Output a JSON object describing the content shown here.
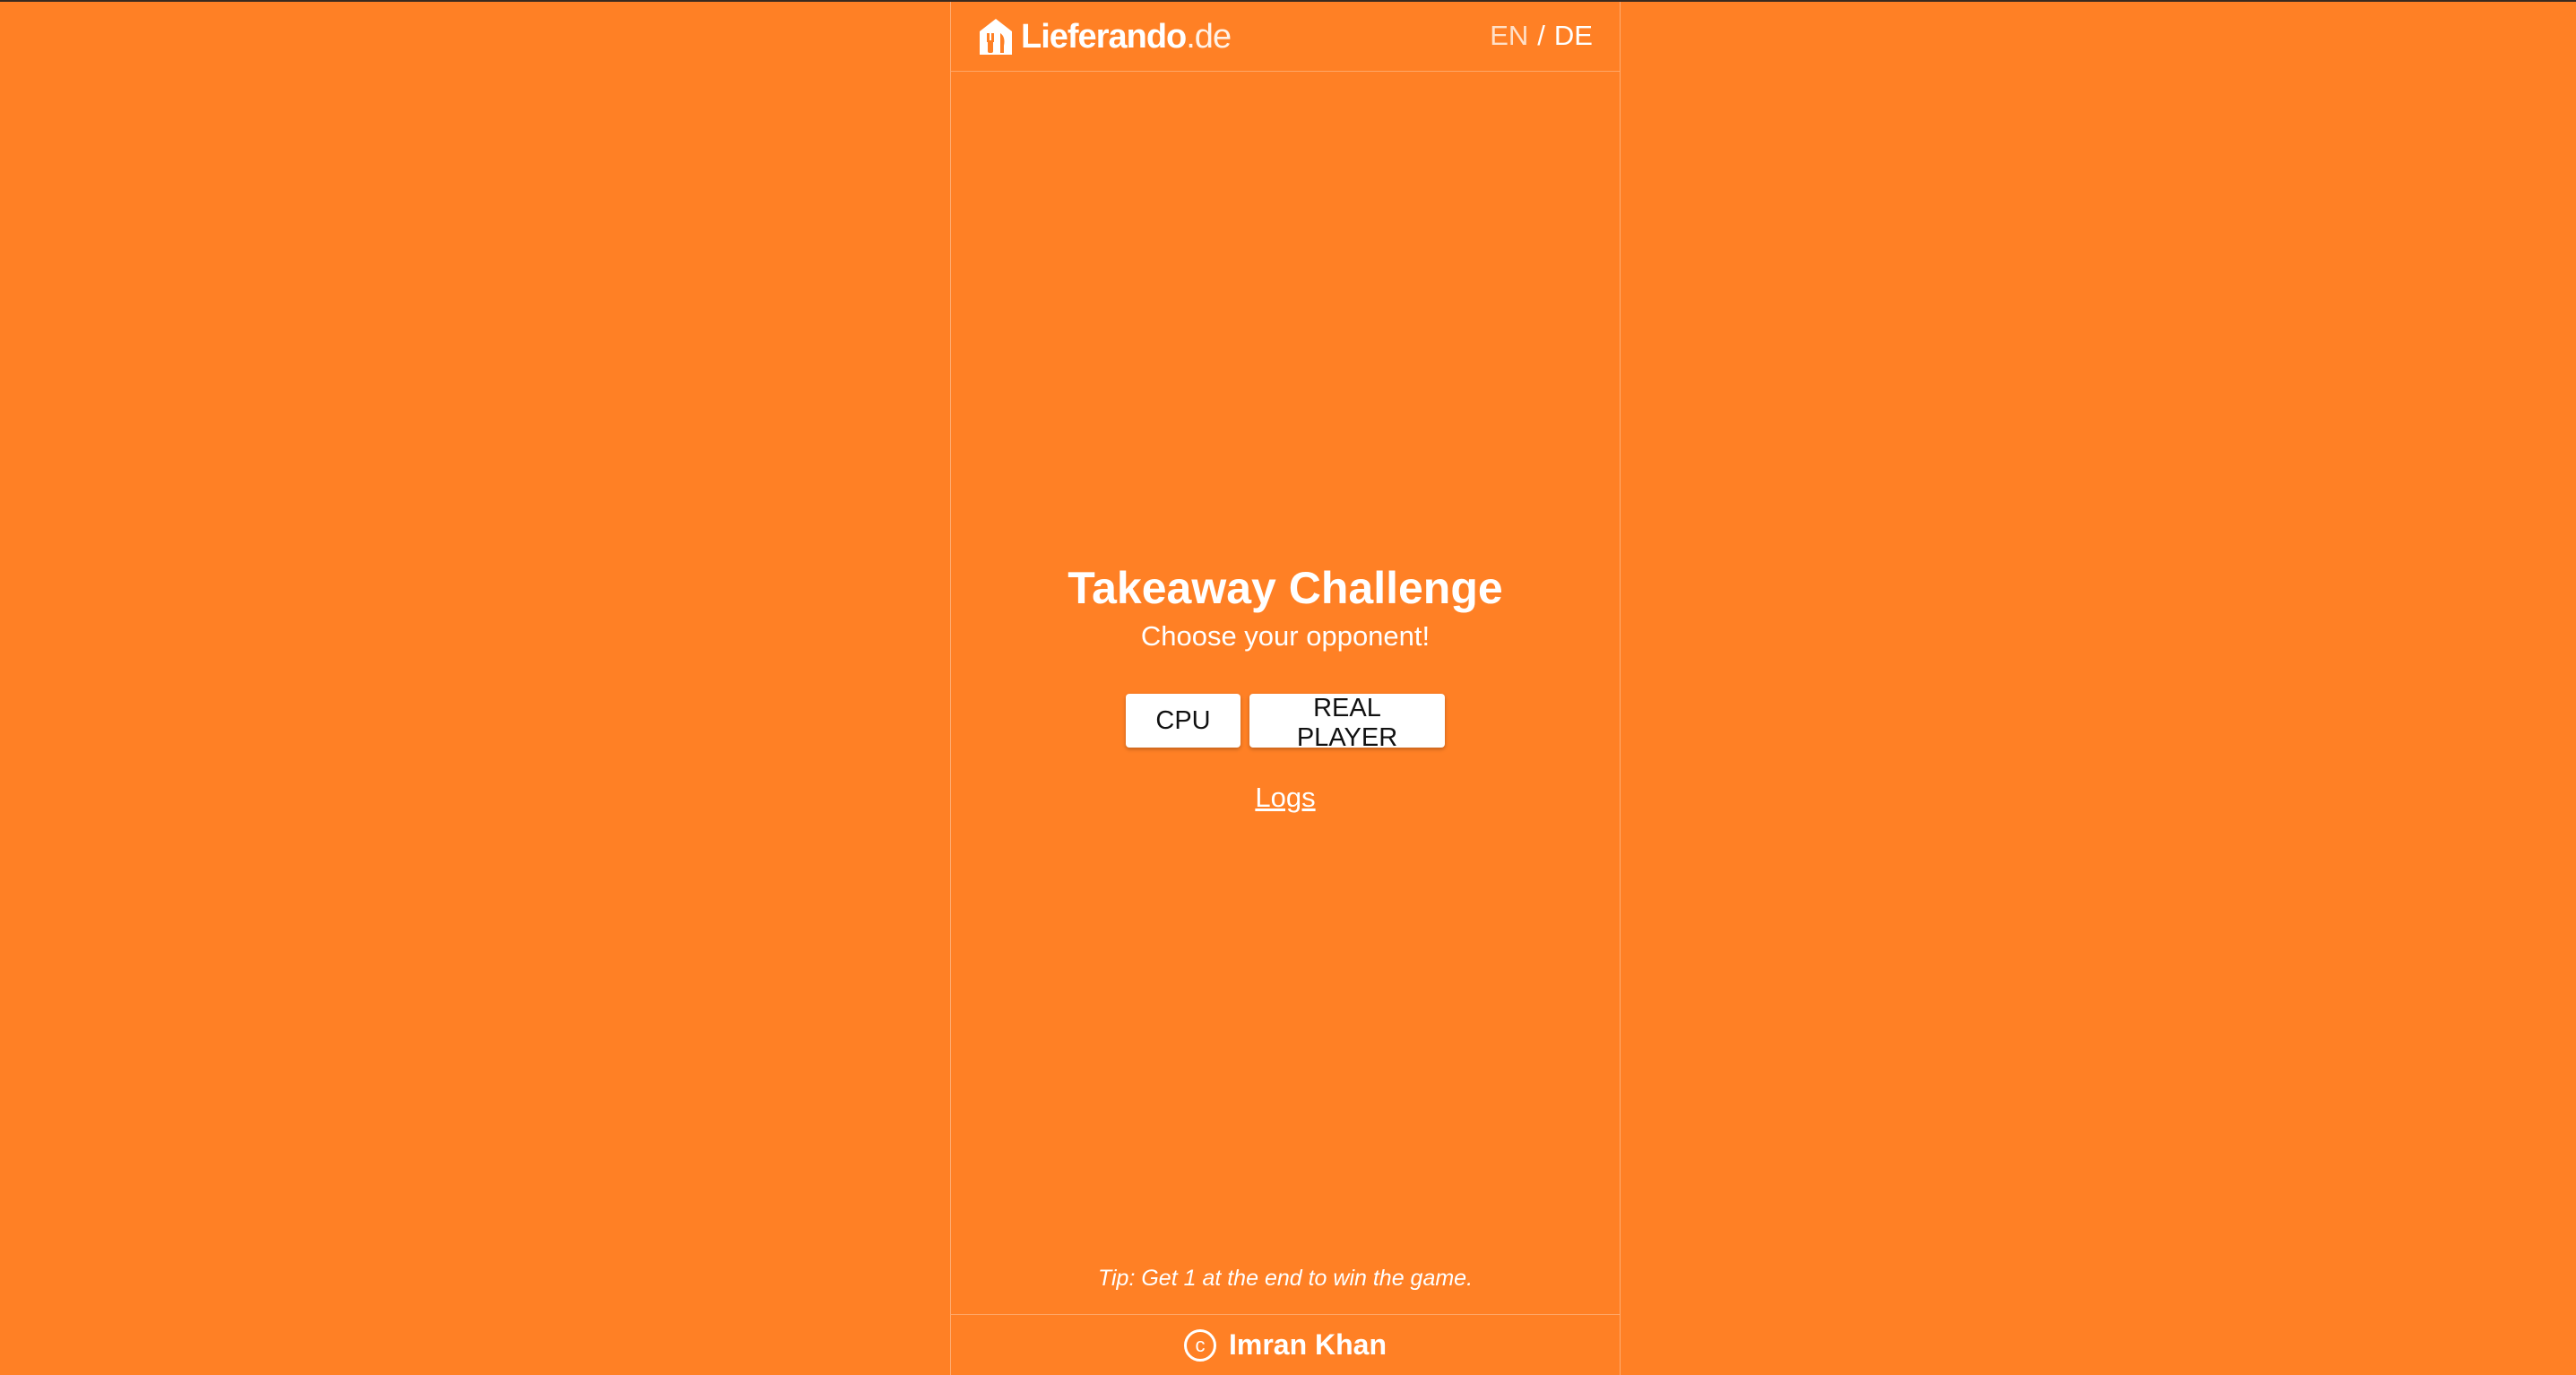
{
  "header": {
    "logo_name": "Lieferando",
    "logo_tld": ".de",
    "logo_icon": "house-fork-knife-icon",
    "lang_en": "EN",
    "lang_separator": "/",
    "lang_de": "DE"
  },
  "main": {
    "title": "Takeaway Challenge",
    "subtitle": "Choose your opponent!",
    "buttons": {
      "cpu_label": "CPU",
      "real_player_label": "REAL PLAYER"
    },
    "logs_link": "Logs"
  },
  "tip": "Tip: Get 1 at the end to win the game.",
  "footer": {
    "copyright_symbol": "c",
    "author": "Imran Khan"
  },
  "colors": {
    "background": "#ff8025",
    "text": "#ffffff",
    "button_bg": "#ffffff",
    "button_text": "#111111"
  }
}
